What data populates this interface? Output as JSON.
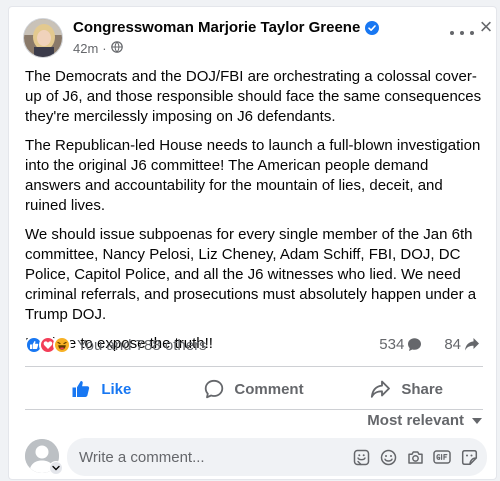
{
  "post": {
    "author": "Congresswoman Marjorie Taylor Greene",
    "time": "42m",
    "separator": "·",
    "paragraphs": [
      "The Democrats and the DOJ/FBI are orchestrating a colossal cover-up of J6, and those responsible should face the same consequences they're mercilessly imposing on J6 defendants.",
      "The Republican-led House needs to launch a full-blown investigation into the original J6 committee! The American people demand answers and accountability for the mountain of lies, deceit, and ruined lives.",
      "We should issue subpoenas for every single member of the Jan 6th committee, Nancy Pelosi, Liz Cheney, Adam Schiff, FBI, DOJ, DC Police, Capitol Police, and all the J6 witnesses who lied. We need criminal referrals, and prosecutions must absolutely happen under a Trump DOJ.",
      "It's time to expose the truth!!"
    ]
  },
  "reactions": {
    "summary": "You and 788 others",
    "comments_count": "534",
    "shares_count": "84"
  },
  "actions": {
    "like": "Like",
    "comment": "Comment",
    "share": "Share"
  },
  "comments": {
    "sort_label": "Most relevant",
    "placeholder": "Write a comment..."
  },
  "colors": {
    "brand_blue": "#1877f2",
    "secondary_text": "#65676b",
    "love_red": "#f33e58",
    "haha_yellow": "#f7b125"
  },
  "icons": {
    "verified": "verified-badge-icon",
    "privacy": "globe-icon",
    "more": "more-dots-icon",
    "close": "close-icon",
    "like": "thumbs-up-icon",
    "comment": "speech-bubble-icon",
    "share": "share-arrow-icon"
  }
}
